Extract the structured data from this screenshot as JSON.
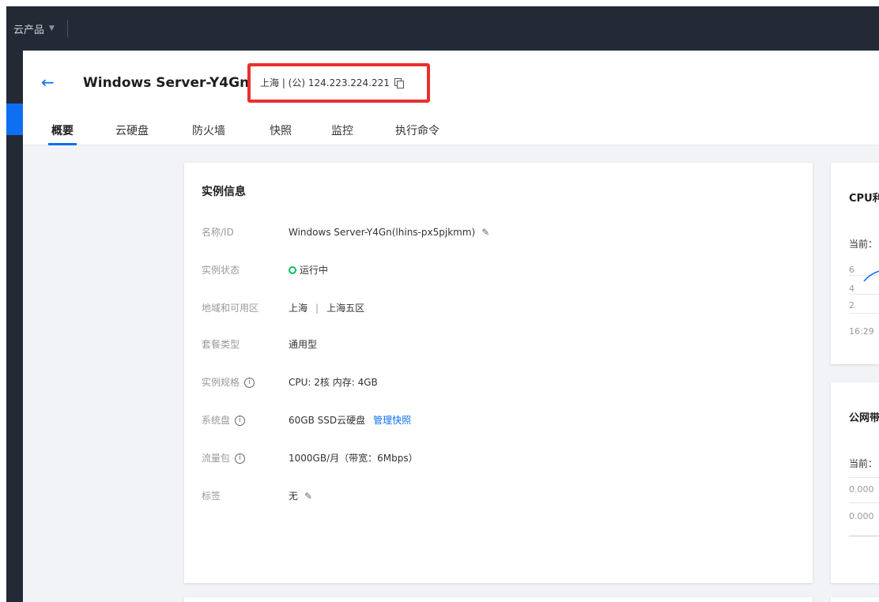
{
  "topbar": {
    "products_label": "云产品"
  },
  "header": {
    "title": "Windows Server-Y4Gn",
    "ip_text": "上海 | (公) 124.223.224.221"
  },
  "tabs": [
    {
      "label": "概要"
    },
    {
      "label": "云硬盘"
    },
    {
      "label": "防火墙"
    },
    {
      "label": "快照"
    },
    {
      "label": "监控"
    },
    {
      "label": "执行命令"
    }
  ],
  "instance": {
    "title": "实例信息",
    "rows": [
      {
        "label": "名称/ID",
        "value": "Windows Server-Y4Gn(lhins-px5pjkmm)"
      },
      {
        "label": "实例状态",
        "value": "运行中"
      },
      {
        "label": "地域和可用区",
        "region": "上海",
        "zone": "上海五区"
      },
      {
        "label": "套餐类型",
        "value": "通用型"
      },
      {
        "label": "实例规格",
        "value": "CPU: 2核 内存: 4GB"
      },
      {
        "label": "系统盘",
        "value": "60GB SSD云硬盘",
        "link": "管理快照"
      },
      {
        "label": "流量包",
        "value": "1000GB/月（带宽：6Mbps）"
      },
      {
        "label": "标签",
        "value": "无"
      }
    ]
  },
  "cpu_card": {
    "title": "CPU利",
    "current": "当前：",
    "ticks": [
      "6",
      "4",
      "2"
    ],
    "time": "16:29"
  },
  "net_card": {
    "title": "公网带",
    "current": "当前：",
    "ticks": [
      "0.000",
      "0.000"
    ]
  },
  "colors": {
    "accent": "#0e6ff2",
    "highlight_box": "#e8302d",
    "running": "#0abf5b",
    "topbar": "#232a35"
  }
}
